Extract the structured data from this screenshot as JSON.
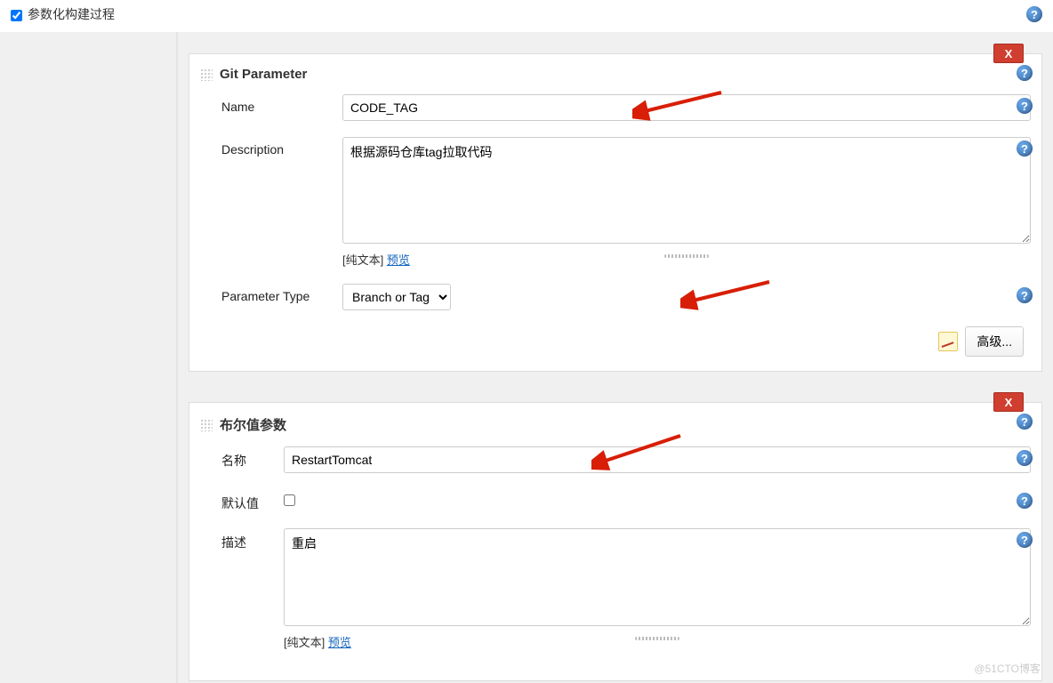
{
  "header": {
    "checkbox_label": "参数化构建过程",
    "checked": true
  },
  "git": {
    "title": "Git Parameter",
    "name_label": "Name",
    "name_value": "CODE_TAG",
    "description_label": "Description",
    "description_value": "根据源码仓库tag拉取代码",
    "desc_footer_plain": "[纯文本]",
    "desc_footer_preview": "预览",
    "param_type_label": "Parameter Type",
    "param_type_value": "Branch or Tag",
    "advanced_button": "高级..."
  },
  "bool": {
    "title": "布尔值参数",
    "name_label": "名称",
    "name_value": "RestartTomcat",
    "default_label": "默认值",
    "default_checked": false,
    "desc_label": "描述",
    "desc_value": "重启",
    "desc_footer_plain": "[纯文本]",
    "desc_footer_preview": "预览"
  },
  "common": {
    "delete_label": "X"
  },
  "watermark": "@51CTO博客"
}
